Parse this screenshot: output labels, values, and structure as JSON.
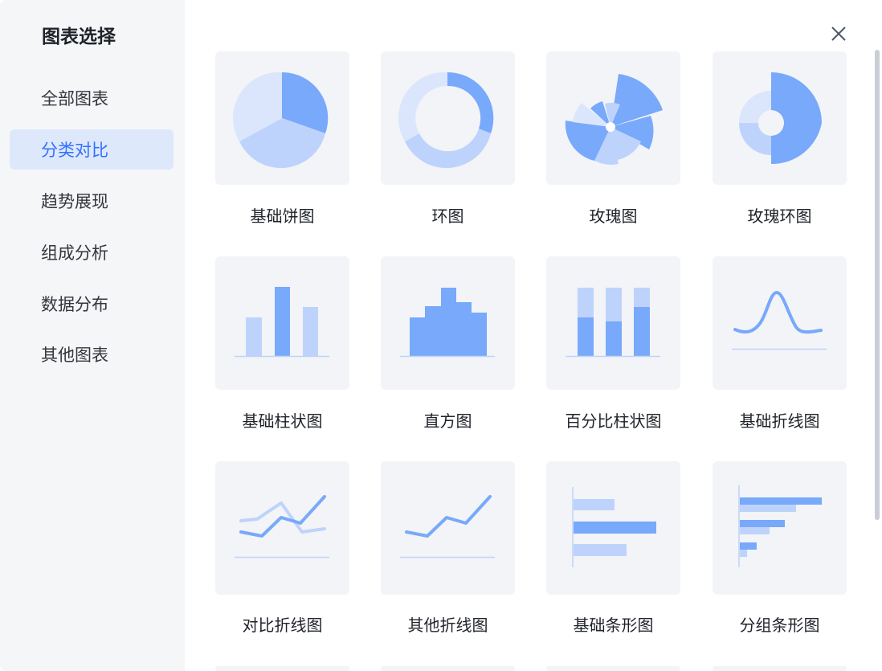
{
  "dialog": {
    "title": "图表选择",
    "close_icon": "close-icon"
  },
  "sidebar": {
    "items": [
      {
        "label": "全部图表",
        "active": false
      },
      {
        "label": "分类对比",
        "active": true
      },
      {
        "label": "趋势展现",
        "active": false
      },
      {
        "label": "组成分析",
        "active": false
      },
      {
        "label": "数据分布",
        "active": false
      },
      {
        "label": "其他图表",
        "active": false
      }
    ]
  },
  "charts": [
    {
      "label": "基础饼图",
      "icon": "basic-pie-chart-icon"
    },
    {
      "label": "环图",
      "icon": "donut-chart-icon"
    },
    {
      "label": "玫瑰图",
      "icon": "rose-chart-icon"
    },
    {
      "label": "玫瑰环图",
      "icon": "rose-donut-chart-icon"
    },
    {
      "label": "基础柱状图",
      "icon": "basic-column-chart-icon"
    },
    {
      "label": "直方图",
      "icon": "histogram-icon"
    },
    {
      "label": "百分比柱状图",
      "icon": "percent-column-chart-icon"
    },
    {
      "label": "基础折线图",
      "icon": "basic-line-chart-icon"
    },
    {
      "label": "对比折线图",
      "icon": "comparison-line-chart-icon"
    },
    {
      "label": "其他折线图",
      "icon": "other-line-chart-icon"
    },
    {
      "label": "基础条形图",
      "icon": "basic-bar-chart-icon"
    },
    {
      "label": "分组条形图",
      "icon": "grouped-bar-chart-icon"
    }
  ],
  "colors": {
    "accent": "#3370ff",
    "chart_dark": "#78a9fa",
    "chart_light": "#bed3fc",
    "chart_lighter": "#dbe6fd",
    "sidebar_bg": "#f5f6f8",
    "card_bg": "#f2f4f7"
  }
}
